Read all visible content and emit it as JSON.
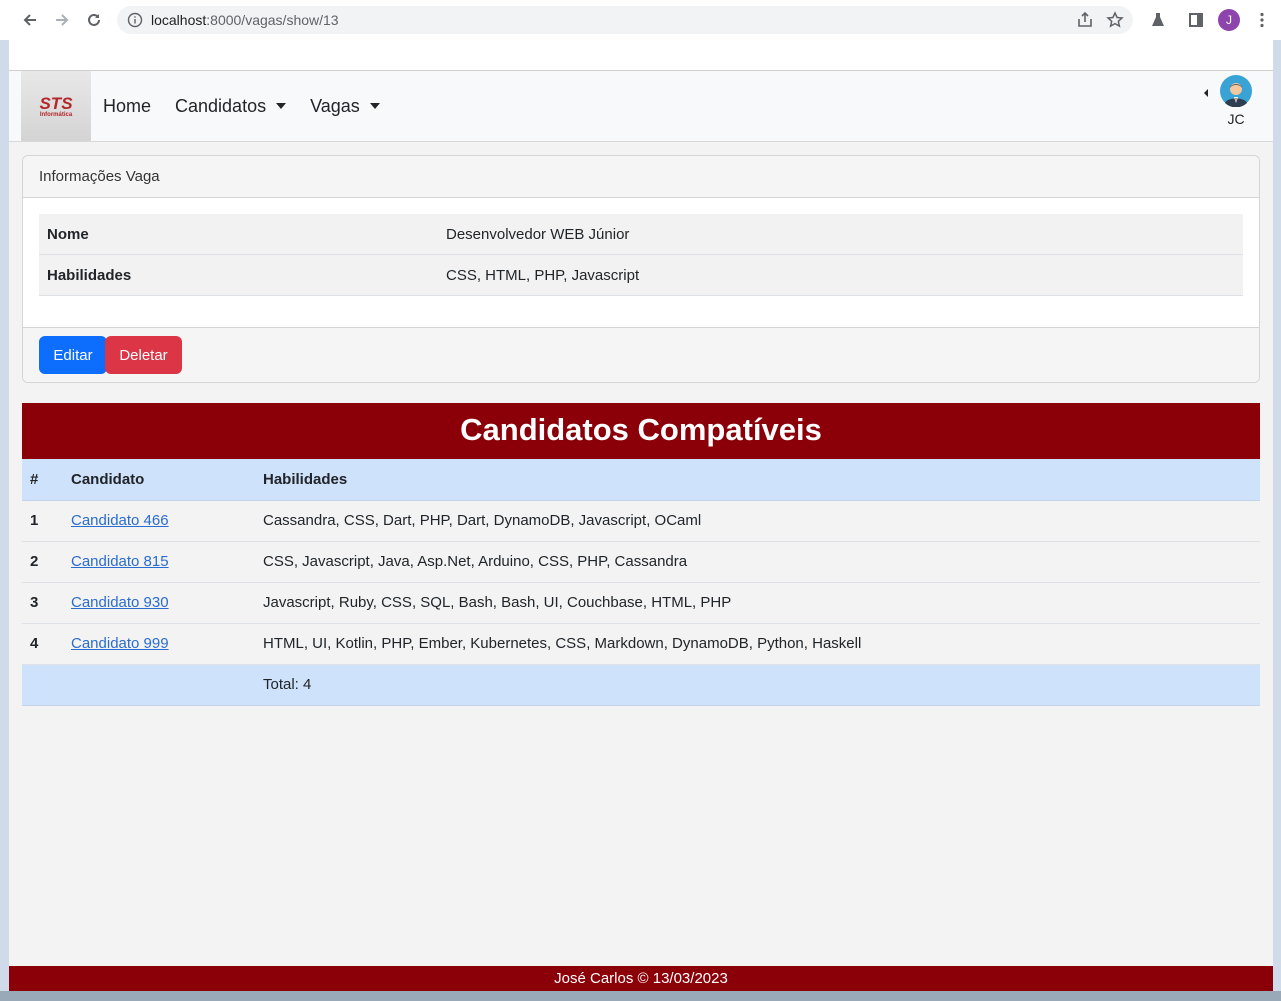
{
  "browser": {
    "url_host": "localhost",
    "url_path": ":8000/vagas/show/13",
    "profile_initial": "J"
  },
  "navbar": {
    "logo_main": "STS",
    "logo_sub": "Informática",
    "home_label": "Home",
    "candidatos_label": "Candidatos",
    "vagas_label": "Vagas",
    "user_initials": "JC"
  },
  "card": {
    "header": "Informações Vaga",
    "rows": [
      {
        "key": "Nome",
        "value": "Desenvolvedor WEB Júnior"
      },
      {
        "key": "Habilidades",
        "value": "CSS, HTML, PHP, Javascript"
      }
    ],
    "edit_label": "Editar",
    "delete_label": "Deletar"
  },
  "candidates": {
    "title": "Candidatos Compatíveis",
    "columns": [
      "#",
      "Candidato",
      "Habilidades"
    ],
    "rows": [
      {
        "num": "1",
        "name": "Candidato 466",
        "skills": "Cassandra, CSS, Dart, PHP, Dart, DynamoDB, Javascript, OCaml"
      },
      {
        "num": "2",
        "name": "Candidato 815",
        "skills": "CSS, Javascript, Java, Asp.Net, Arduino, CSS, PHP, Cassandra"
      },
      {
        "num": "3",
        "name": "Candidato 930",
        "skills": "Javascript, Ruby, CSS, SQL, Bash, Bash, UI, Couchbase, HTML, PHP"
      },
      {
        "num": "4",
        "name": "Candidato 999",
        "skills": "HTML, UI, Kotlin, PHP, Ember, Kubernetes, CSS, Markdown, DynamoDB, Python, Haskell"
      }
    ],
    "total": "Total: 4"
  },
  "footer": {
    "text": "José Carlos © 13/03/2023"
  },
  "colors": {
    "brand_red": "#8b0008",
    "primary": "#0d6efd",
    "danger": "#dc3545",
    "table_head": "#cfe2fc"
  }
}
